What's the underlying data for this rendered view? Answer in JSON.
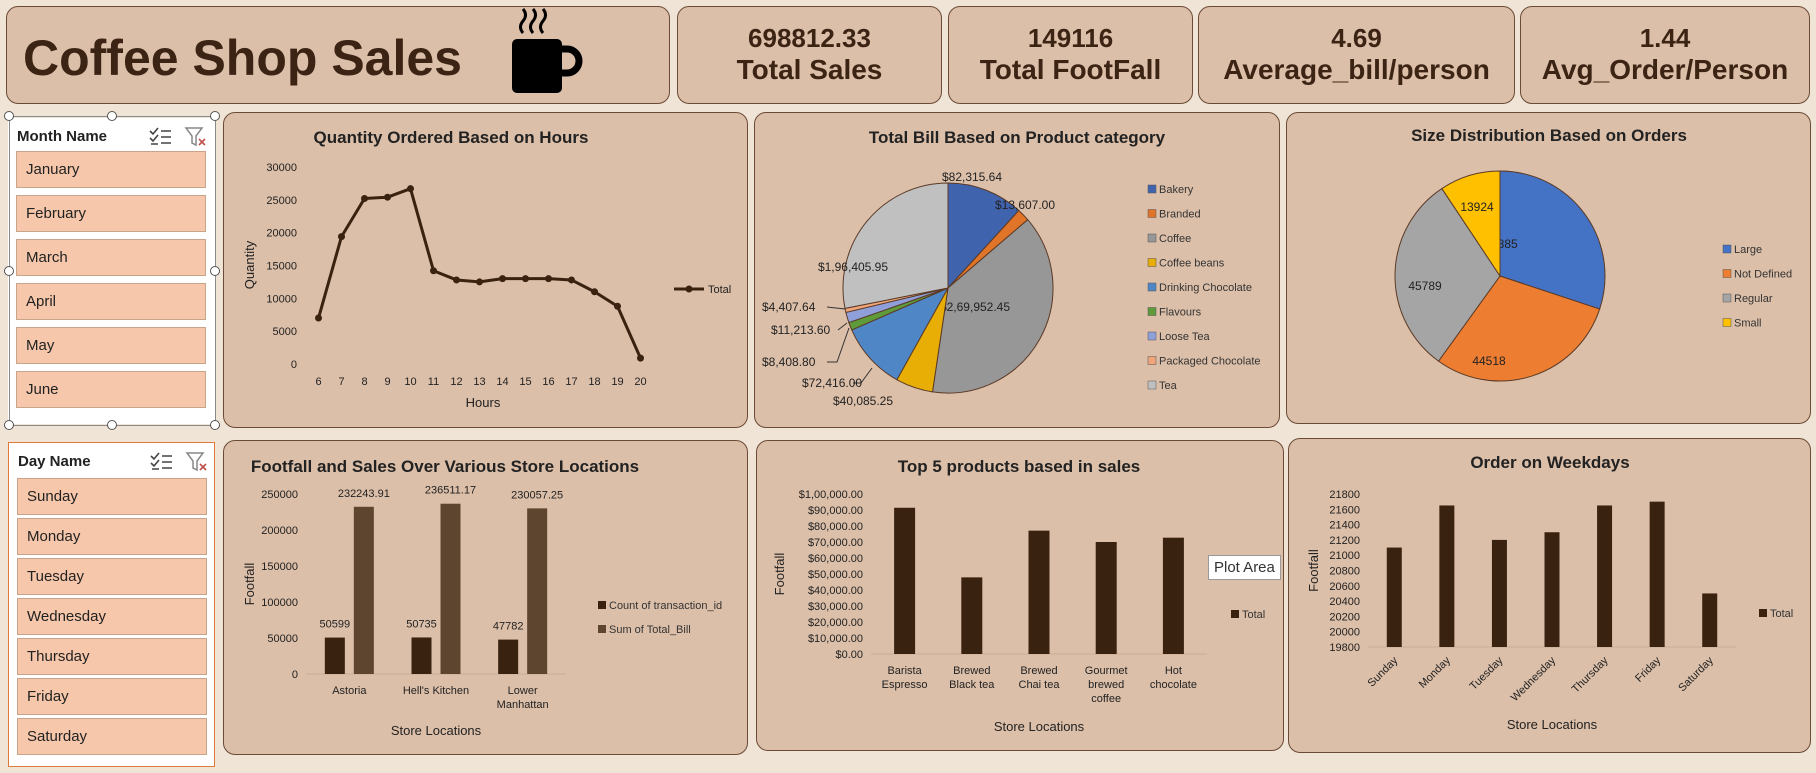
{
  "dashboard": {
    "title": "Coffee Shop Sales",
    "kpis": [
      {
        "value": "698812.33",
        "label": "Total Sales"
      },
      {
        "value": "149116",
        "label": "Total FootFall"
      },
      {
        "value": "4.69",
        "label": "Average_bill/person"
      },
      {
        "value": "1.44",
        "label": "Avg_Order/Person"
      }
    ]
  },
  "slicers": {
    "month": {
      "header": "Month Name",
      "items": [
        "January",
        "February",
        "March",
        "April",
        "May",
        "June"
      ]
    },
    "day": {
      "header": "Day Name",
      "items": [
        "Sunday",
        "Monday",
        "Tuesday",
        "Wednesday",
        "Thursday",
        "Friday",
        "Saturday"
      ]
    }
  },
  "tooltip": "Plot Area",
  "colors": {
    "bar_dark": "#3a2211",
    "bar_brown": "#5e4530",
    "panel": "#dcbfa9",
    "slicer_item": "#f6c7aa"
  },
  "chart_data": [
    {
      "type": "line",
      "title": "Quantity Ordered  Based on Hours",
      "xlabel": "Hours",
      "ylabel": "Quantity",
      "ylim": [
        0,
        30000
      ],
      "yticks": [
        "0",
        "5000",
        "10000",
        "15000",
        "20000",
        "25000",
        "30000"
      ],
      "x": [
        "6",
        "7",
        "8",
        "9",
        "10",
        "11",
        "12",
        "13",
        "14",
        "15",
        "16",
        "17",
        "18",
        "19",
        "20"
      ],
      "series": [
        {
          "name": "Total",
          "values": [
            7000,
            19400,
            25200,
            25400,
            26700,
            14200,
            12800,
            12500,
            13000,
            13000,
            13000,
            12800,
            11000,
            8800,
            900
          ]
        }
      ],
      "legend": "right"
    },
    {
      "type": "pie",
      "title": "Total Bill Based on Product category",
      "categories": [
        "Bakery",
        "Branded",
        "Coffee",
        "Coffee beans",
        "Drinking Chocolate",
        "Flavours",
        "Loose Tea",
        "Packaged Chocolate",
        "Tea"
      ],
      "values": [
        82315.64,
        13607.0,
        269952.45,
        40085.25,
        72416.0,
        8408.8,
        11213.6,
        4407.64,
        196405.95
      ],
      "labels": [
        "$82,315.64",
        "$13,607.00",
        "$2,69,952.45",
        "$40,085.25",
        "$72,416.00",
        "$8,408.80",
        "$11,213.60",
        "$4,407.64",
        "$1,96,405.95"
      ],
      "colors": [
        "#3f63ad",
        "#e07428",
        "#979797",
        "#e8ae06",
        "#4f86c6",
        "#5f9b3a",
        "#8f9fd9",
        "#f0a479",
        "#c0c0c0"
      ],
      "legend": "right"
    },
    {
      "type": "pie",
      "title": "Size Distribution Based on Orders",
      "categories": [
        "Large",
        "Not Defined",
        "Regular",
        "Small"
      ],
      "values": [
        44885,
        44518,
        45789,
        13924
      ],
      "labels": [
        "44885",
        "44518",
        "45789",
        "13924"
      ],
      "colors": [
        "#4472c4",
        "#ed7d31",
        "#a5a5a5",
        "#ffc000"
      ],
      "legend": "right"
    },
    {
      "type": "bar",
      "title": "Footfall and Sales Over Various Store Locations",
      "xlabel": "Store Locations",
      "ylabel": "Footfall",
      "ylim": [
        0,
        250000
      ],
      "yticks": [
        "0",
        "50000",
        "100000",
        "150000",
        "200000",
        "250000"
      ],
      "categories": [
        "Astoria",
        "Hell's Kitchen",
        "Lower Manhattan"
      ],
      "series": [
        {
          "name": "Count of transaction_id",
          "values": [
            50599,
            50735,
            47782
          ],
          "labels": [
            "50599",
            "50735",
            "47782"
          ]
        },
        {
          "name": "Sum of Total_Bill",
          "values": [
            232243.91,
            236511.17,
            230057.25
          ],
          "labels": [
            "232243.91",
            "236511.17",
            "230057.25"
          ]
        }
      ],
      "legend": "right"
    },
    {
      "type": "bar",
      "title": "Top 5 products based in sales",
      "xlabel": "Store Locations",
      "ylabel": "Footfall",
      "ylim": [
        0,
        100000
      ],
      "yticks": [
        "$0.00",
        "$10,000.00",
        "$20,000.00",
        "$30,000.00",
        "$40,000.00",
        "$50,000.00",
        "$60,000.00",
        "$70,000.00",
        "$80,000.00",
        "$90,000.00",
        "$1,00,000.00"
      ],
      "categories": [
        "Barista Espresso",
        "Brewed Black tea",
        "Brewed Chai tea",
        "Gourmet brewed coffee",
        "Hot chocolate"
      ],
      "series": [
        {
          "name": "Total",
          "values": [
            91400,
            47900,
            77100,
            70000,
            72700
          ]
        }
      ],
      "legend": "right"
    },
    {
      "type": "bar",
      "title": "Order on Weekdays",
      "xlabel": "Store Locations",
      "ylabel": "Footfall",
      "ylim": [
        19800,
        21800
      ],
      "yticks": [
        "19800",
        "20000",
        "20200",
        "20400",
        "20600",
        "20800",
        "21000",
        "21200",
        "21400",
        "21600",
        "21800"
      ],
      "categories": [
        "Sunday",
        "Monday",
        "Tuesday",
        "Wednesday",
        "Thursday",
        "Friday",
        "Saturday"
      ],
      "series": [
        {
          "name": "Total",
          "values": [
            21100,
            21650,
            21200,
            21300,
            21650,
            21700,
            20500
          ]
        }
      ],
      "legend": "right"
    }
  ]
}
